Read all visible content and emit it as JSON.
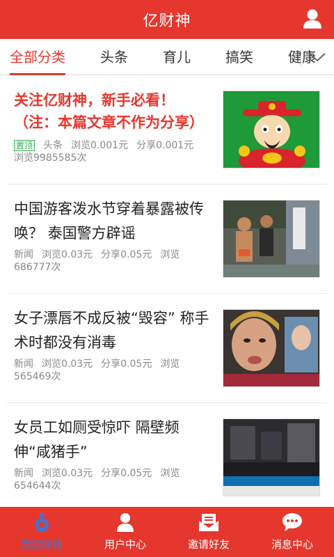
{
  "app": {
    "title": "亿财神"
  },
  "tabs": {
    "items": [
      "全部分类",
      "头条",
      "育儿",
      "搞笑",
      "健康"
    ],
    "active_index": 0
  },
  "articles": [
    {
      "headline": "关注亿财神，新手必看！（注：本篇文章不作为分享）",
      "pinned": true,
      "pin_label": "置顶",
      "category": "头条",
      "view_reward": "浏览0.001元",
      "share_reward": "分享0.001元",
      "views": "浏览9985585次",
      "thumb": "fortune-god-cartoon"
    },
    {
      "headline": "中国游客泼水节穿着暴露被传唤？ 泰国警方辟谣",
      "pinned": false,
      "category": "新闻",
      "view_reward": "浏览0.03元",
      "share_reward": "分享0.05元",
      "views_label": "浏览",
      "views_count": "686777次",
      "thumb": "water-festival-street-photo"
    },
    {
      "headline": "女子漂唇不成反被“毁容” 称手术时都没有消毒",
      "pinned": false,
      "category": "新闻",
      "view_reward": "浏览0.03元",
      "share_reward": "分享0.05元",
      "views_label": "浏览",
      "views_count": "565469次",
      "thumb": "woman-face-closeup-photo"
    },
    {
      "headline": "女员工如厕受惊吓 隔壁频伸“咸猪手”",
      "pinned": false,
      "category": "新闻",
      "view_reward": "浏览0.03元",
      "share_reward": "分享0.05元",
      "views_label": "浏览",
      "views_count": "654644次",
      "thumb": "news-tv-screenshot"
    }
  ],
  "bottom_nav": {
    "items": [
      {
        "label": "我要赚钱",
        "icon": "money-bag-icon"
      },
      {
        "label": "用户中心",
        "icon": "user-icon"
      },
      {
        "label": "邀请好友",
        "icon": "invite-envelope-icon"
      },
      {
        "label": "消息中心",
        "icon": "chat-bubble-icon"
      }
    ],
    "active_index": 0
  },
  "colors": {
    "brand_red": "#e5372e",
    "nav_active_blue": "#4a72c9",
    "pin_green": "#2da94f"
  }
}
